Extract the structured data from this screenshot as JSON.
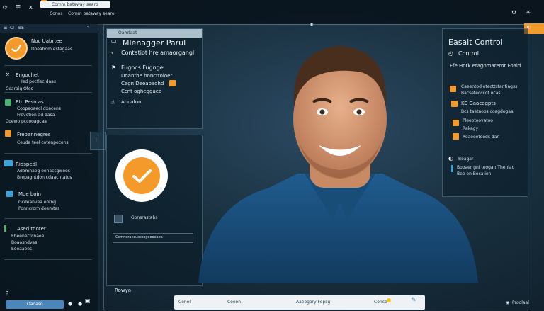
{
  "topbar": {
    "search_text": "Comm bataway searo",
    "search_prefix": "Conos",
    "right_icons": [
      "settings-icon",
      "brightness-icon"
    ]
  },
  "secondary_bar": {
    "left": "Cl",
    "right": "BE"
  },
  "sidebar": {
    "profile": {
      "title": "Noc Uabrtee",
      "subtitle": "Doeabom estagaas"
    },
    "items": [
      {
        "title": "Engochet",
        "line1": "Ied pocfiec daas",
        "line2": "Cearaig Ofos"
      },
      {
        "title": "Etc Pesrcas",
        "line1": "Coopaoaecl dxacens",
        "line2": "Frevetion ad dasa",
        "line3": "Coewo pccooagcaa"
      },
      {
        "title": "Frepannegres",
        "line1": "Ceuda teel cotenpecens"
      },
      {
        "title": "Ridspedl",
        "line1": "Adomnaeg oenaccgwees",
        "line2": "Brepagntdon cdaacntatos"
      },
      {
        "title": "Moe boin",
        "line1": "Gcdeanvea eorng",
        "line2": "Ponncrorh deemtas"
      },
      {
        "title": "Ased tdoter",
        "line1": "Ebeenecrcnaee",
        "line2": "Boaosndvas",
        "line3": "Eeeaaees"
      }
    ],
    "ok_button": "Oaoaso",
    "footer_icons": [
      "help-icon",
      "expand-icon"
    ]
  },
  "main_panel": {
    "tab": "Oamtaat",
    "title": "Mlenagger Parul",
    "subtitle": "Contatiot hre amaorgangl",
    "section": "Fugocs Fugnge",
    "lines": [
      "Doanthe boncttoloer",
      "Cegn Deeaoaohd",
      "Ccnt ogheggaeo"
    ],
    "footer": "Ahcafon"
  },
  "lower_panel": {
    "checkbox_label": "Gonsrastabs",
    "field_text": "Ccmnoraccuotoogooooaoa"
  },
  "bottom_left": {
    "label": "Rowya"
  },
  "bottombar": {
    "items": [
      "Cenol",
      "Coeon",
      "Aaeogary Fopsg",
      "Conco"
    ]
  },
  "bottom_right": {
    "label": "Proolaal"
  },
  "right_panel": {
    "title": "Easalt Control",
    "subtitle": "Control",
    "section": "Ffe Hotk etagomaremt Foald",
    "rows": [
      {
        "title": "Caeentod etecttstantiagss",
        "sub": "Bacsetecccot ocas"
      },
      {
        "title": "KC Gaacegpts",
        "sub": "Bcs taetaoos coagdogaa"
      },
      {
        "title": "Pleeotoovatoo",
        "sub": "Rakagy"
      },
      {
        "title": "Reaeeetoeds dan"
      }
    ],
    "extra_title": "Boagar",
    "extra_line": "Booaer gni teogan Theniao",
    "extra_line2": "Bee on Bocaiion"
  },
  "accent_colors": {
    "orange": "#f39a2a",
    "blue": "#3aa3d9",
    "green": "#49b36f"
  }
}
